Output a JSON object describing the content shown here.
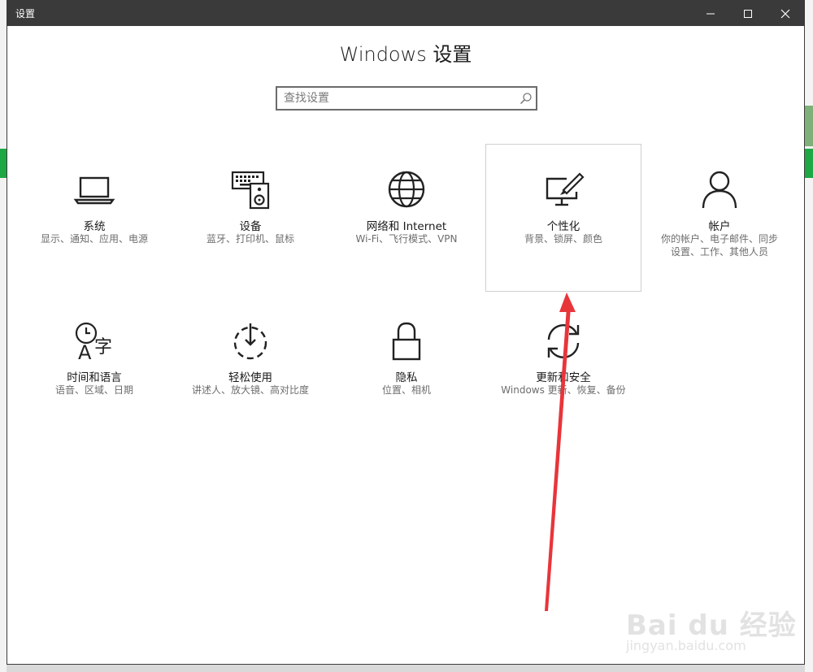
{
  "window": {
    "title": "设置"
  },
  "heading": "Windows 设置",
  "search": {
    "placeholder": "查找设置"
  },
  "tiles": [
    {
      "name": "系统",
      "desc": "显示、通知、应用、电源",
      "icon": "laptop-icon"
    },
    {
      "name": "设备",
      "desc": "蓝牙、打印机、鼠标",
      "icon": "keyboard-speaker-icon"
    },
    {
      "name": "网络和 Internet",
      "desc": "Wi-Fi、飞行模式、VPN",
      "icon": "globe-icon"
    },
    {
      "name": "个性化",
      "desc": "背景、锁屏、颜色",
      "icon": "paint-monitor-icon"
    },
    {
      "name": "帐户",
      "desc": "你的帐户、电子邮件、同步设置、工作、其他人员",
      "icon": "person-icon"
    },
    {
      "name": "时间和语言",
      "desc": "语音、区域、日期",
      "icon": "clock-language-icon"
    },
    {
      "name": "轻松使用",
      "desc": "讲述人、放大镜、高对比度",
      "icon": "ease-of-access-icon"
    },
    {
      "name": "隐私",
      "desc": "位置、相机",
      "icon": "lock-icon"
    },
    {
      "name": "更新和安全",
      "desc": "Windows 更新、恢复、备份",
      "icon": "sync-icon"
    }
  ],
  "annotation": {
    "color": "#e8353a"
  },
  "watermark": {
    "main": "Bai du 经验",
    "sub": "jingyan.baidu.com"
  }
}
